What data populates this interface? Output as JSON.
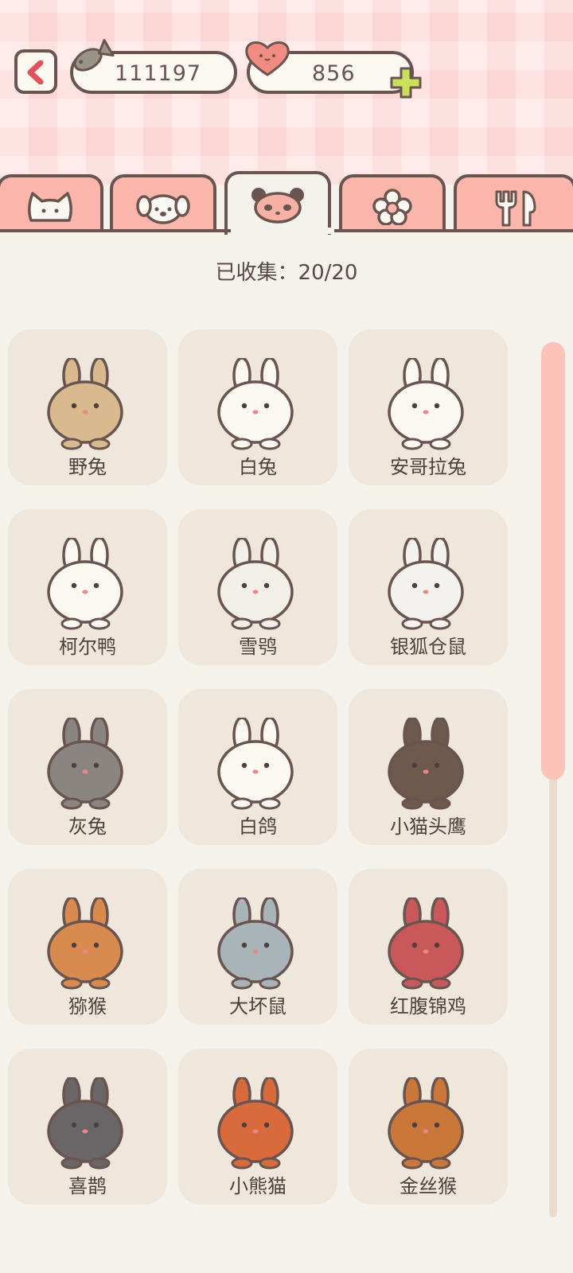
{
  "currency": {
    "fish": "111197",
    "hearts": "856"
  },
  "icons": {
    "back": "chevron-left-icon",
    "fish": "fish-icon",
    "heart": "heart-icon",
    "plus": "plus-icon"
  },
  "tabs": [
    {
      "icon": "cat-icon",
      "active": false
    },
    {
      "icon": "dog-icon",
      "active": false
    },
    {
      "icon": "panda-icon",
      "active": true
    },
    {
      "icon": "flower-icon",
      "active": false
    },
    {
      "icon": "utensils-icon",
      "active": false
    }
  ],
  "collection": {
    "status": "已收集：20/20"
  },
  "animals": [
    {
      "name": "野兔",
      "color": "#d9b98e"
    },
    {
      "name": "白兔",
      "color": "#fbf7f1"
    },
    {
      "name": "安哥拉兔",
      "color": "#fbf7f1"
    },
    {
      "name": "柯尔鸭",
      "color": "#fbf7f1"
    },
    {
      "name": "雪鸮",
      "color": "#f2efe9"
    },
    {
      "name": "银狐仓鼠",
      "color": "#f4f2ef"
    },
    {
      "name": "灰兔",
      "color": "#8a8581"
    },
    {
      "name": "白鸽",
      "color": "#fbf7f1"
    },
    {
      "name": "小猫头鹰",
      "color": "#6e5a4c"
    },
    {
      "name": "猕猴",
      "color": "#d98a4e"
    },
    {
      "name": "大坏鼠",
      "color": "#a8b4b8"
    },
    {
      "name": "红腹锦鸡",
      "color": "#c8585a"
    },
    {
      "name": "喜鹊",
      "color": "#6a6566"
    },
    {
      "name": "小熊猫",
      "color": "#d96a3c"
    },
    {
      "name": "金丝猴",
      "color": "#c9783a"
    }
  ],
  "colors": {
    "header_bg": "#fcd6d4",
    "tab_bg": "#fbb6ac",
    "outline": "#6a5450",
    "accent_back": "#e0525a",
    "plus": "#c8e05a",
    "page_bg": "#f5f2ec",
    "card_bg": "#efe7dc",
    "scroll_thumb": "#fdc2b8"
  }
}
